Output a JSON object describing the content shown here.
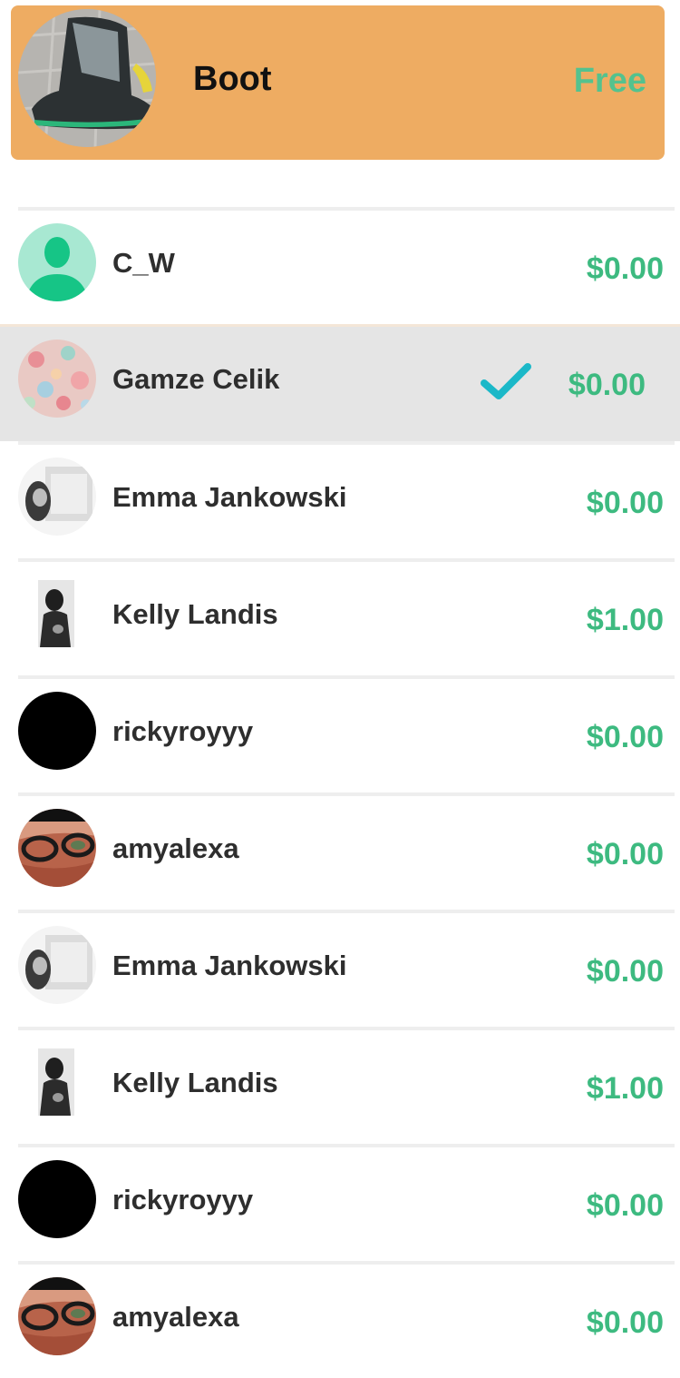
{
  "header": {
    "title": "Boot",
    "price": "Free",
    "image_icon": "boot-photo"
  },
  "colors": {
    "header_bg": "#eeac62",
    "price_green": "#3dba80",
    "check_teal": "#1bb8c8",
    "selected_row_bg": "#e5e5e5"
  },
  "users": [
    {
      "name": "C_W",
      "price": "$0.00",
      "avatar": "default-person-avatar",
      "selected": false
    },
    {
      "name": "Gamze Celik",
      "price": "$0.00",
      "avatar": "floral-pattern-avatar",
      "selected": true
    },
    {
      "name": "Emma Jankowski",
      "price": "$0.00",
      "avatar": "photo-avatar",
      "selected": false
    },
    {
      "name": "Kelly Landis",
      "price": "$1.00",
      "avatar": "photo-avatar",
      "selected": false
    },
    {
      "name": "rickyroyyy",
      "price": "$0.00",
      "avatar": "black-avatar",
      "selected": false
    },
    {
      "name": "amyalexa",
      "price": "$0.00",
      "avatar": "selfie-avatar",
      "selected": false
    },
    {
      "name": "Emma Jankowski",
      "price": "$0.00",
      "avatar": "photo-avatar",
      "selected": false
    },
    {
      "name": "Kelly Landis",
      "price": "$1.00",
      "avatar": "photo-avatar",
      "selected": false
    },
    {
      "name": "rickyroyyy",
      "price": "$0.00",
      "avatar": "black-avatar",
      "selected": false
    },
    {
      "name": "amyalexa",
      "price": "$0.00",
      "avatar": "selfie-avatar",
      "selected": false
    }
  ]
}
